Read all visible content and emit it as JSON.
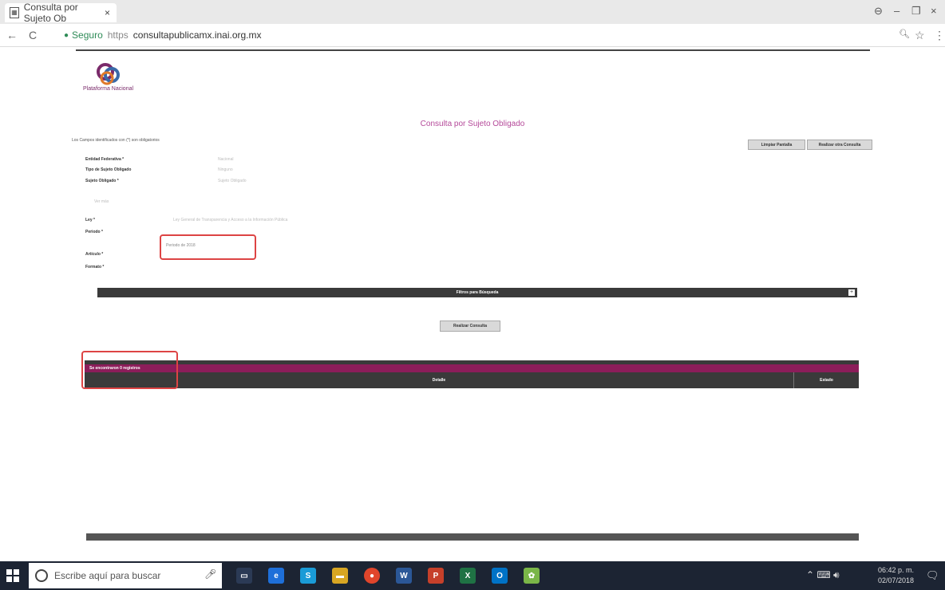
{
  "browser": {
    "tab_title": "Consulta por Sujeto Ob",
    "tab_close": "×",
    "url_secure": "Seguro",
    "url_scheme": "https",
    "url_host": "consultapublicamx.inai.org.mx",
    "window_minimize": "–",
    "window_maximize": "❐",
    "window_close": "×",
    "back": "←",
    "reload": "C",
    "zoom": "🔍︎",
    "star": "☆",
    "menu": "⋮",
    "profile": "⊖"
  },
  "page": {
    "logo_text": "Plataforma Nacional",
    "title": "Consulta por Sujeto Obligado",
    "required_note": "Los Campos identificados con (*) son obligatorios",
    "btn_clear": "Limpiar Pantalla",
    "btn_new": "Realizar otra Consulta",
    "fields": {
      "entidad_label": "Entidad Federativa *",
      "entidad_value": "Nacional",
      "tipo_label": "Tipo de Sujeto Obligado",
      "tipo_value": "Ninguno",
      "sujeto_label": "Sujeto Obligado *",
      "sujeto_value": "Sujeto Obligado",
      "ver_mas": "Ver más",
      "ley_label": "Ley *",
      "ley_value": "Ley General de Transparencia y Acceso a la Información Pública",
      "periodo_label": "Periodo *",
      "periodo_value": "Periodo de 2018",
      "articulo_label": "Artículo *",
      "articulo_value": "",
      "formato_label": "Formato *",
      "formato_value": ""
    },
    "filter_bar": "Filtros para Búsqueda",
    "filter_toggle": "+",
    "btn_search": "Realizar Consulta",
    "right_link": "",
    "results_bar": "Se encontraron 0 registros",
    "th_detalle": "Detalle",
    "th_estado": "Estado",
    "export_link": ""
  },
  "taskbar": {
    "search_placeholder": "Escribe aquí para buscar",
    "mic": "🎤︎",
    "time": "06:42 p. m.",
    "date": "02/07/2018",
    "tray": "⌃ ⌨ 🔊︎",
    "notif": "🗨"
  },
  "colors": {
    "accent": "#8c1d5a",
    "title": "#b54a9a",
    "dark_bar": "#3a3a3a",
    "highlight": "#dd4444"
  }
}
